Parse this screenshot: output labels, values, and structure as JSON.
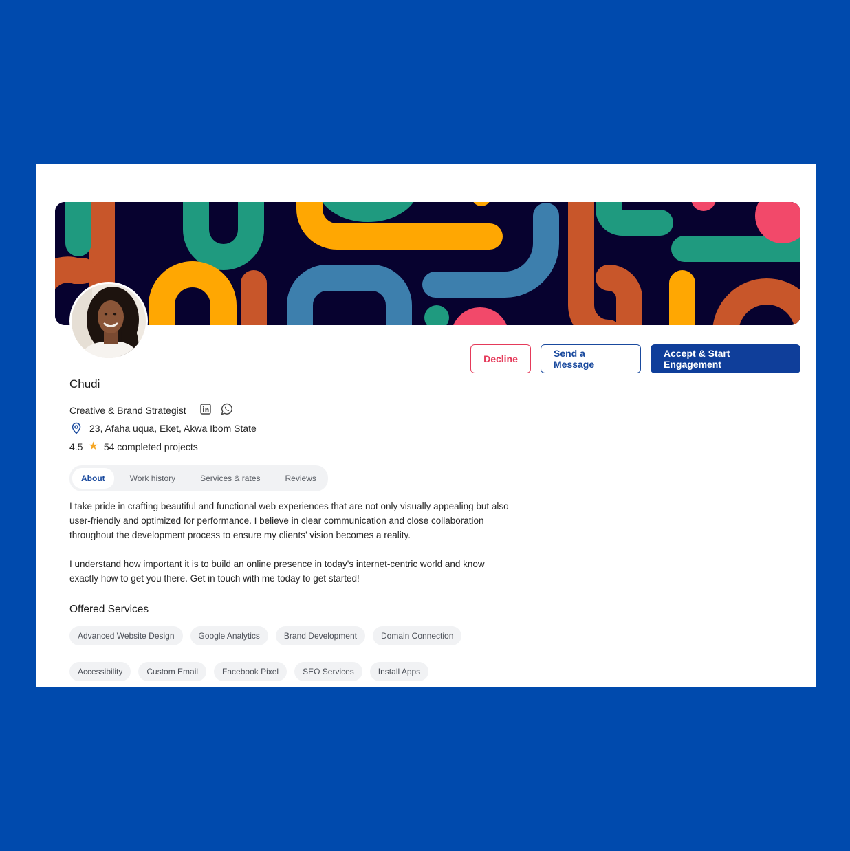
{
  "colors": {
    "page_bg": "#004aad",
    "accent": "#0f3e9a",
    "decline": "#e53a5a",
    "star": "#f5a623"
  },
  "actions": {
    "decline": "Decline",
    "message": "Send a Message",
    "accept": "Accept & Start Engagement"
  },
  "profile": {
    "name": "Chudi",
    "role": "Creative & Brand Strategist",
    "location": "23, Afaha uqua, Eket, Akwa Ibom State",
    "rating": "4.5",
    "projects": "54 completed projects",
    "social_icons": [
      "linkedin-icon",
      "whatsapp-icon"
    ]
  },
  "tabs": [
    {
      "label": "About",
      "active": true
    },
    {
      "label": "Work history",
      "active": false
    },
    {
      "label": "Services & rates",
      "active": false
    },
    {
      "label": "Reviews",
      "active": false
    }
  ],
  "about": {
    "paragraph1": "I take pride in crafting beautiful and functional web experiences that are not only visually appealing but also user-friendly and optimized for performance. I believe in clear communication and close collaboration throughout the development process to ensure my clients’  vision becomes a reality.",
    "paragraph2": "I understand how important it is to build an online presence in today's internet-centric world and know exactly how to get you there.  Get in touch with me today to get started!"
  },
  "services": {
    "title": "Offered Services",
    "items": [
      "Advanced Website Design",
      "Google Analytics",
      "Brand Development",
      "Domain Connection",
      "Accessibility",
      "Custom Email",
      "Facebook Pixel",
      "SEO Services",
      "Install Apps"
    ]
  }
}
